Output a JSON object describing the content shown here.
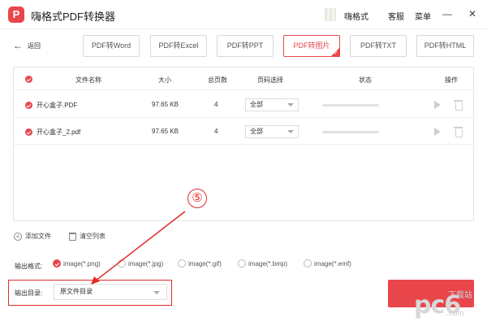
{
  "app": {
    "logo_letter": "P",
    "title": "嗨格式PDF转换器"
  },
  "titlebar": {
    "user": "嗨格式",
    "service": "客服",
    "menu": "菜单",
    "minimize": "—",
    "close": "✕"
  },
  "toolbar": {
    "back": "返回",
    "tabs": [
      {
        "label": "PDF转Word",
        "active": false
      },
      {
        "label": "PDF转Excel",
        "active": false
      },
      {
        "label": "PDF转PPT",
        "active": false
      },
      {
        "label": "PDF转图片",
        "active": true
      },
      {
        "label": "PDF转TXT",
        "active": false
      },
      {
        "label": "PDF转HTML",
        "active": false
      }
    ]
  },
  "table": {
    "headers": {
      "name": "文件名称",
      "size": "大小",
      "pages": "总页数",
      "page_select": "页码选择",
      "status": "状态",
      "action": "操作"
    },
    "rows": [
      {
        "name": "开心盒子.PDF",
        "size": "97.65 KB",
        "pages": "4",
        "page_select": "全部",
        "progress": 0
      },
      {
        "name": "开心盒子_2.pdf",
        "size": "97.65 KB",
        "pages": "4",
        "page_select": "全部",
        "progress": 0
      }
    ]
  },
  "actions": {
    "add_file": "添加文件",
    "clear_list": "清空列表"
  },
  "output_format": {
    "label": "输出格式:",
    "options": [
      {
        "label": "image(*.png)",
        "selected": true
      },
      {
        "label": "image(*.jpg)",
        "selected": false
      },
      {
        "label": "image(*.gif)",
        "selected": false
      },
      {
        "label": "image(*.bmp)",
        "selected": false
      },
      {
        "label": "image(*.emf)",
        "selected": false
      }
    ]
  },
  "output_dir": {
    "label": "输出目录:",
    "value": "原文件目录"
  },
  "annotation": {
    "step": "⑤"
  },
  "watermark": {
    "brand": "pc6",
    "download": "下载站",
    "url": ".com"
  },
  "colors": {
    "accent": "#e8464b",
    "annotation": "#e42a2a"
  }
}
